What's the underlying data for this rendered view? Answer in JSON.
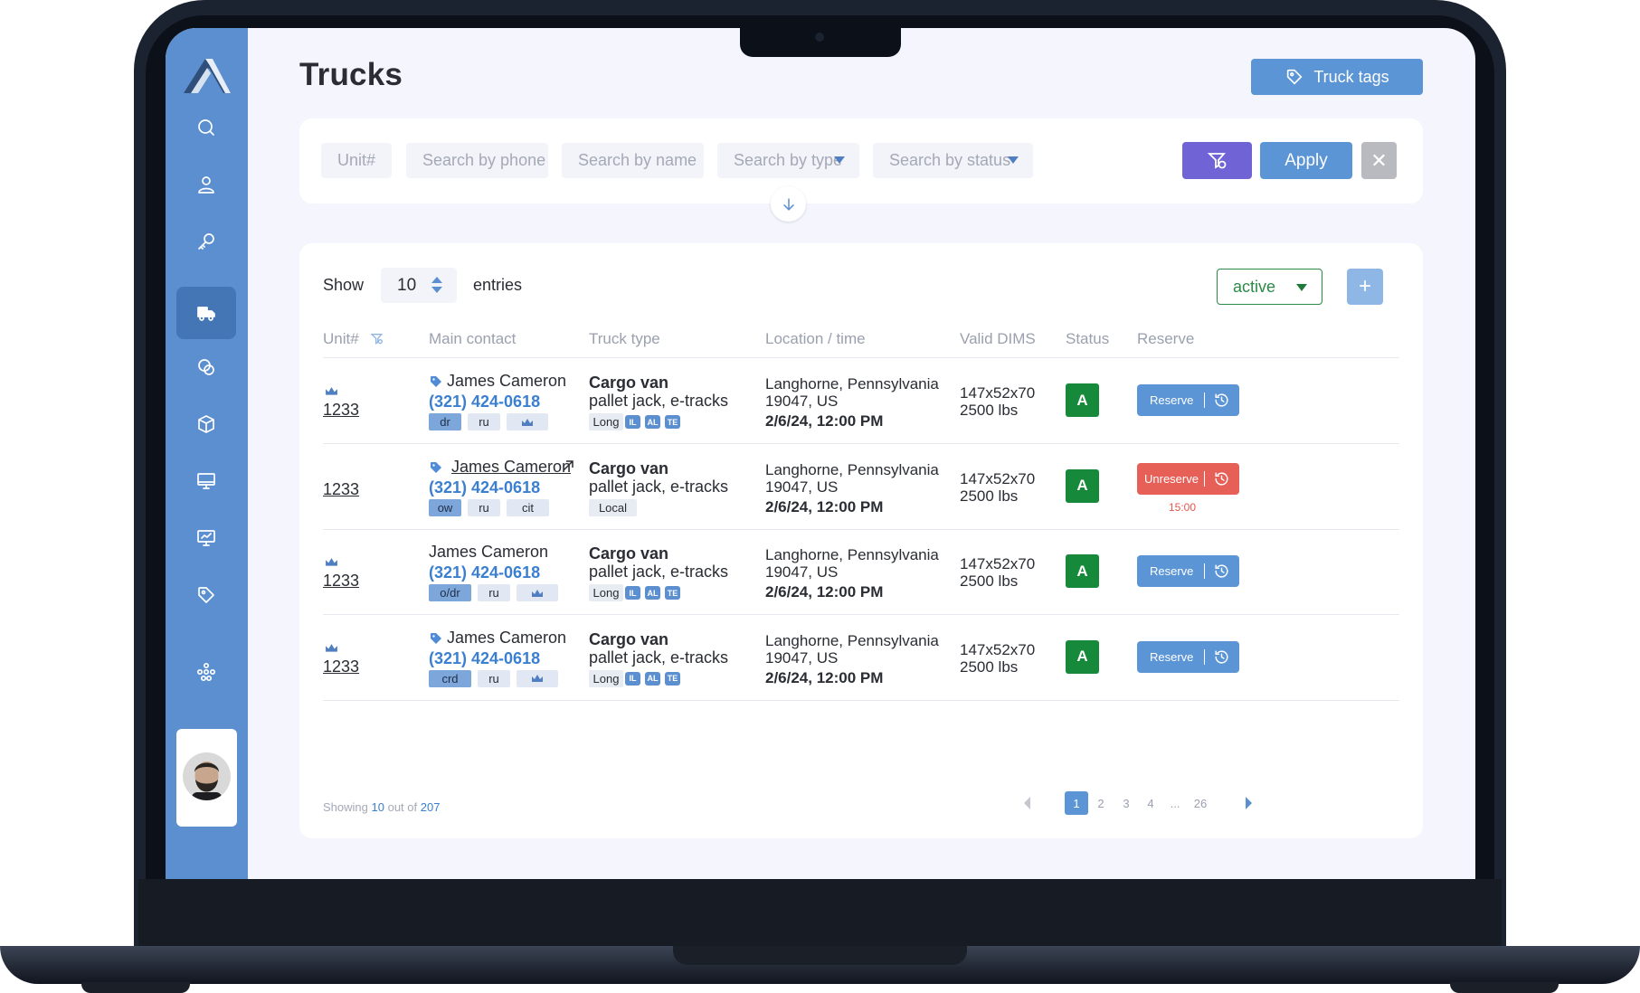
{
  "header": {
    "title": "Trucks",
    "tags_button": "Truck tags"
  },
  "filters": {
    "unit_placeholder": "Unit#",
    "phone_placeholder": "Search by phone",
    "name_placeholder": "Search by name",
    "type_placeholder": "Search by type",
    "status_placeholder": "Search by status",
    "apply": "Apply",
    "clear": "✕"
  },
  "table": {
    "show": "Show",
    "page_size": "10",
    "entries": "entries",
    "status_filter": "active",
    "add": "+",
    "columns": [
      "Unit#",
      "Main contact",
      "Truck type",
      "Location / time",
      "Valid DIMS",
      "Status",
      "Reserve"
    ],
    "rows": [
      {
        "unit": "1233",
        "crown": true,
        "tag_icon": true,
        "link_icon": false,
        "name": "James Cameron",
        "phone": "(321) 424-0618",
        "chips": [
          "dr",
          "ru"
        ],
        "chip_crown": true,
        "type_title": "Cargo van",
        "type_sub": "pallet jack, e-tracks",
        "range": "Long",
        "minis": [
          "IL",
          "AL",
          "TE"
        ],
        "loc1": "Langhorne, Pennsylvania",
        "loc2": "19047, US",
        "time": "2/6/24, 12:00 PM",
        "dims": "147x52x70",
        "weight": "2500 lbs",
        "status": "A",
        "reserve": "Reserve",
        "reserved": false,
        "timer": ""
      },
      {
        "unit": "1233",
        "crown": false,
        "tag_icon": true,
        "link_icon": true,
        "name": "James Cameron",
        "phone": "(321) 424-0618",
        "chips": [
          "ow",
          "ru",
          "cit"
        ],
        "chip_crown": false,
        "type_title": "Cargo van",
        "type_sub": "pallet jack, e-tracks",
        "range": "Local",
        "minis": [],
        "loc1": "Langhorne, Pennsylvania",
        "loc2": "19047, US",
        "time": "2/6/24, 12:00 PM",
        "dims": "147x52x70",
        "weight": "2500 lbs",
        "status": "A",
        "reserve": "Unreserve",
        "reserved": true,
        "timer": "15:00"
      },
      {
        "unit": "1233",
        "crown": true,
        "tag_icon": false,
        "link_icon": false,
        "name": "James Cameron",
        "phone": "(321) 424-0618",
        "chips": [
          "o/dr",
          "ru"
        ],
        "chip_crown": true,
        "type_title": "Cargo van",
        "type_sub": "pallet jack, e-tracks",
        "range": "Long",
        "minis": [
          "IL",
          "AL",
          "TE"
        ],
        "loc1": "Langhorne, Pennsylvania",
        "loc2": "19047, US",
        "time": "2/6/24, 12:00 PM",
        "dims": "147x52x70",
        "weight": "2500 lbs",
        "status": "A",
        "reserve": "Reserve",
        "reserved": false,
        "timer": ""
      },
      {
        "unit": "1233",
        "crown": true,
        "tag_icon": true,
        "link_icon": false,
        "name": "James Cameron",
        "phone": "(321) 424-0618",
        "chips": [
          "crd",
          "ru"
        ],
        "chip_crown": true,
        "type_title": "Cargo van",
        "type_sub": "pallet jack, e-tracks",
        "range": "Long",
        "minis": [
          "IL",
          "AL",
          "TE"
        ],
        "loc1": "Langhorne, Pennsylvania",
        "loc2": "19047, US",
        "time": "2/6/24, 12:00 PM",
        "dims": "147x52x70",
        "weight": "2500 lbs",
        "status": "A",
        "reserve": "Reserve",
        "reserved": false,
        "timer": ""
      }
    ]
  },
  "footer": {
    "showing": "Showing",
    "count": "10",
    "out_of": "out of",
    "total": "207"
  },
  "pagination": {
    "pages": [
      "1",
      "2",
      "3",
      "4",
      "...",
      "26"
    ],
    "current": "1"
  },
  "sidebar": {
    "icons": [
      "search-icon",
      "user-icon",
      "key-icon",
      "truck-icon",
      "coins-icon",
      "box-icon",
      "monitor-icon",
      "presentation-icon",
      "tag-icon",
      "network-icon"
    ]
  },
  "colors": {
    "sidebar": "#5b8fd0",
    "primary": "#5b95d6",
    "accent": "#6f63d6",
    "status_green": "#168a3a",
    "unreserve_red": "#e66058"
  }
}
